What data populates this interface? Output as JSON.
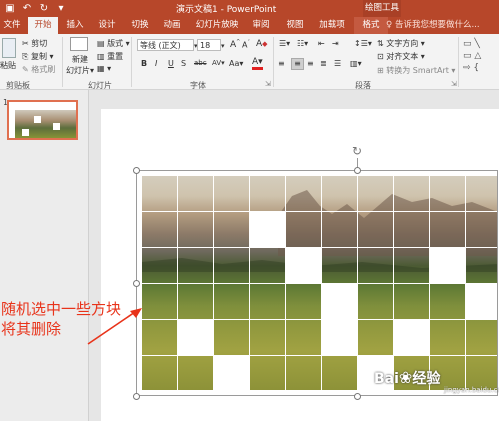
{
  "window": {
    "title": "演示文稿1 - PowerPoint",
    "context_tool": "绘图工具"
  },
  "quick_access": [
    "save-icon",
    "undo-icon",
    "redo-icon",
    "customize-icon"
  ],
  "tabs": [
    {
      "label": "文件"
    },
    {
      "label": "开始",
      "active": true
    },
    {
      "label": "插入"
    },
    {
      "label": "设计"
    },
    {
      "label": "切换"
    },
    {
      "label": "动画"
    },
    {
      "label": "幻灯片放映"
    },
    {
      "label": "审阅"
    },
    {
      "label": "视图"
    },
    {
      "label": "加载项"
    },
    {
      "label": "格式",
      "context": true
    }
  ],
  "tell_me": "告诉我您想要做什么...",
  "ribbon": {
    "clipboard": {
      "paste": "粘贴",
      "cut": "剪切",
      "copy": "复制",
      "format_painter": "格式刷",
      "label": "剪贴板"
    },
    "slides": {
      "new_slide_line1": "新建",
      "new_slide_line2": "幻灯片",
      "layout": "版式",
      "reset": "重置",
      "label": "幻灯片"
    },
    "font": {
      "family": "等线 (正文)",
      "size": "18",
      "bold": "B",
      "italic": "I",
      "underline": "U",
      "shadow": "S",
      "strike": "abc",
      "spacing": "AV",
      "case": "Aa",
      "color_letter": "A",
      "grow": "A",
      "shrink": "A",
      "clear": "A",
      "label": "字体"
    },
    "paragraph": {
      "text_direction": "文字方向",
      "align_text": "对齐文本",
      "smartart": "转换为 SmartArt",
      "label": "段落"
    }
  },
  "slide_pane": {
    "slide_number": "1"
  },
  "annotation": {
    "line1": "随机选中一些方块",
    "line2": "将其删除"
  },
  "watermark": {
    "brand": "Bai",
    "brand2": "经验",
    "url": "jingyan.baidu.com"
  },
  "colors": {
    "accent": "#b7472a",
    "annotation": "#e8331a"
  }
}
